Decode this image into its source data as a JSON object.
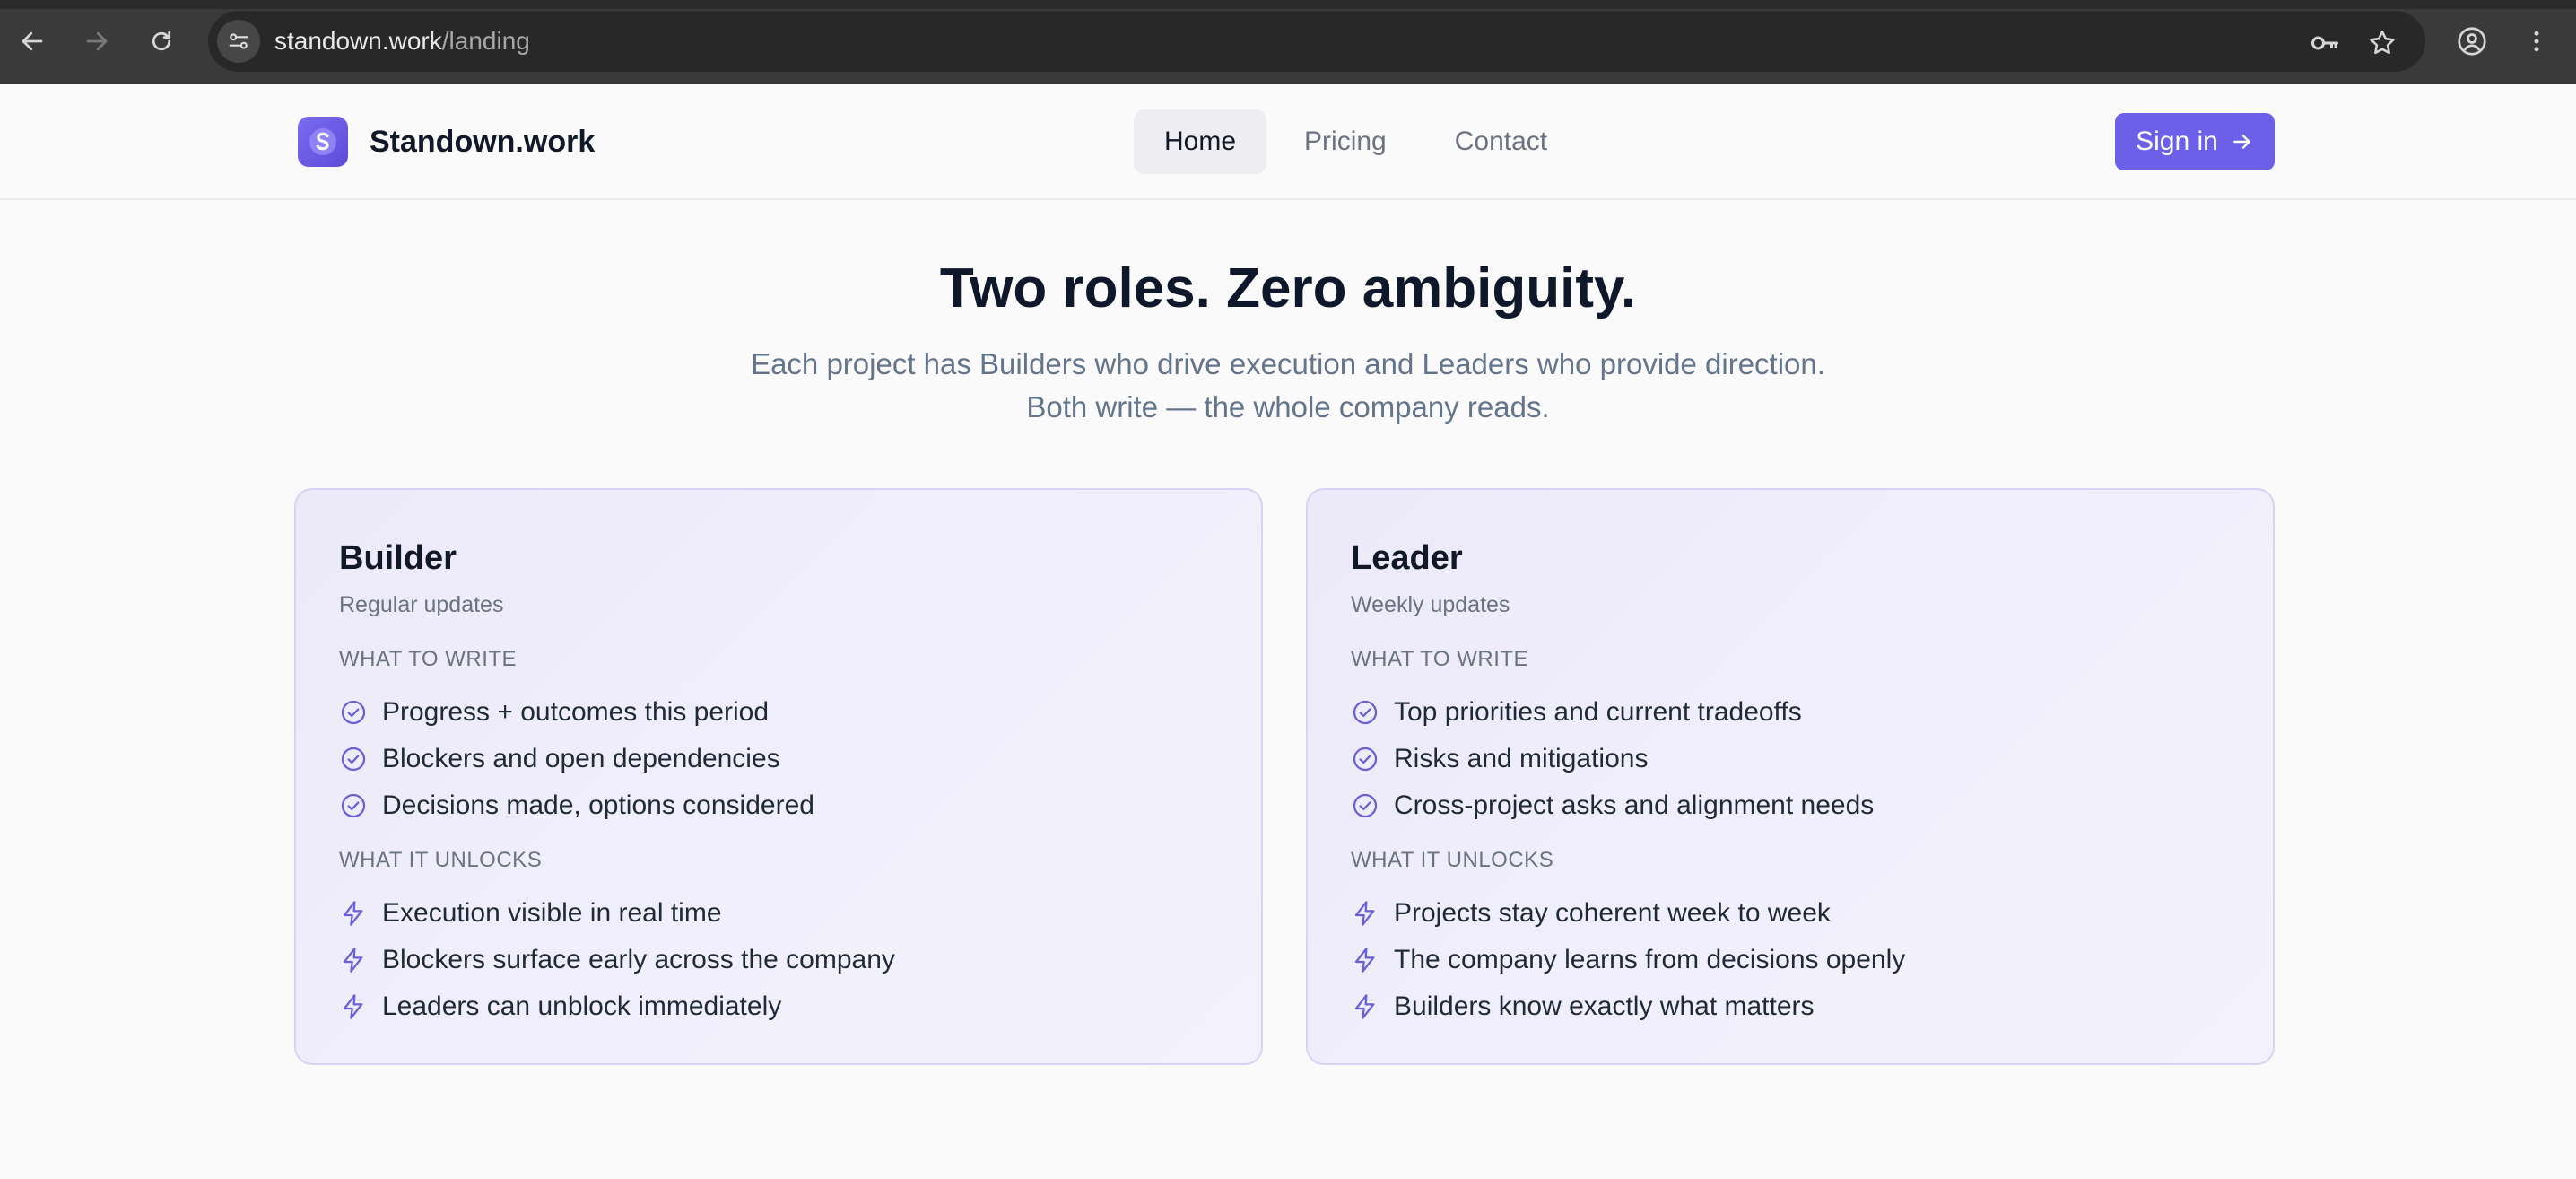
{
  "browser": {
    "url_host": "standown.work",
    "url_path": "/landing"
  },
  "header": {
    "brand": "Standown.work",
    "nav": [
      "Home",
      "Pricing",
      "Contact"
    ],
    "active_nav": "Home",
    "signin_label": "Sign in"
  },
  "hero": {
    "title": "Two roles. Zero ambiguity.",
    "subtitle": "Each project has Builders who drive execution and Leaders who provide direction. Both write — the whole company reads."
  },
  "cards": [
    {
      "title": "Builder",
      "subtitle": "Regular updates",
      "write_label": "WHAT TO WRITE",
      "write_items": [
        "Progress + outcomes this period",
        "Blockers and open dependencies",
        "Decisions made, options considered"
      ],
      "unlock_label": "WHAT IT UNLOCKS",
      "unlock_items": [
        "Execution visible in real time",
        "Blockers surface early across the company",
        "Leaders can unblock immediately"
      ]
    },
    {
      "title": "Leader",
      "subtitle": "Weekly updates",
      "write_label": "WHAT TO WRITE",
      "write_items": [
        "Top priorities and current tradeoffs",
        "Risks and mitigations",
        "Cross-project asks and alignment needs"
      ],
      "unlock_label": "WHAT IT UNLOCKS",
      "unlock_items": [
        "Projects stay coherent week to week",
        "The company learns from decisions openly",
        "Builders know exactly what matters"
      ]
    }
  ],
  "icons": {
    "write_item": "check-circle-icon",
    "unlock_item": "lightning-icon"
  },
  "colors": {
    "accent": "#6c5fe8",
    "card_border": "#d8d2f5",
    "icon": "#6a5fd6"
  }
}
